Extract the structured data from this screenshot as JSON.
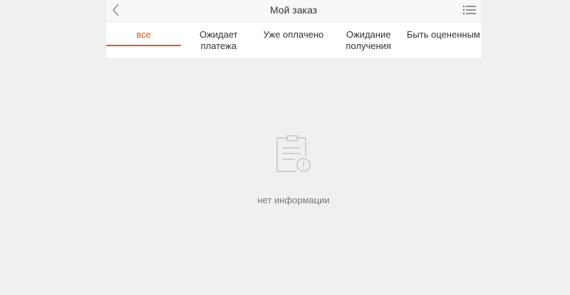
{
  "header": {
    "title": "Мой заказ",
    "back_icon": "chevron-left-icon",
    "menu_icon": "list-menu-icon"
  },
  "tabs": [
    {
      "label": "все",
      "active": true
    },
    {
      "label": "Ожидает платежа",
      "active": false
    },
    {
      "label": "Уже оплачено",
      "active": false
    },
    {
      "label": "Ожидание получения",
      "active": false
    },
    {
      "label": "Быть оцененным",
      "active": false
    }
  ],
  "empty_state": {
    "icon": "document-alert-icon",
    "text": "нет информации"
  },
  "colors": {
    "accent": "#e2561c",
    "background": "#f0f0f0",
    "text": "#333333",
    "muted": "#777777"
  }
}
